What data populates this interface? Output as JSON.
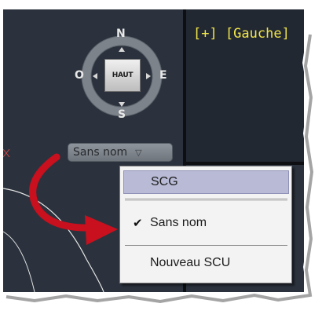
{
  "viewport": {
    "view_label": "[+] [Gauche]"
  },
  "viewcube": {
    "north": "N",
    "south": "S",
    "east": "E",
    "west": "O",
    "face_label": "HAUT"
  },
  "ucs_dropdown": {
    "selected": "Sans nom",
    "icon": "chevron-down-icon"
  },
  "context_menu": {
    "items": [
      {
        "label": "SCG",
        "selected": true
      },
      {
        "label": "Sans nom",
        "checked": true
      },
      {
        "label": "Nouveau SCU"
      }
    ]
  },
  "colors": {
    "viewport_bg": "#2b323d",
    "view_label": "#f2e64a",
    "menu_highlight": "#b9bbd6",
    "arrow": "#c8101e"
  }
}
